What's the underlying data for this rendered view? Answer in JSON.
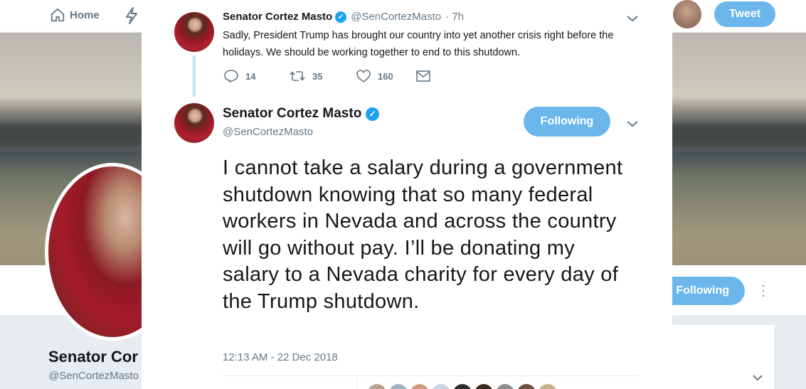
{
  "nav": {
    "home_label": "Home",
    "tweet_button": "Tweet"
  },
  "profile": {
    "name": "Senator Cor",
    "handle": "@SenCortezMasto",
    "following_button": "Following"
  },
  "thread": [
    {
      "author": "Senator Cortez Masto",
      "handle": "@SenCortezMasto",
      "time": "· 7h",
      "text": "Sadly, President Trump has brought our country into yet another crisis right before the holidays. We should be working together to end to this shutdown.",
      "replies": "14",
      "retweets": "35",
      "likes": "160"
    }
  ],
  "main_tweet": {
    "author": "Senator Cortez Masto",
    "handle": "@SenCortezMasto",
    "following_button": "Following",
    "text": "I cannot take a salary during a government shutdown knowing that so many federal workers in Nevada and across the country will go without pay. I’ll be donating my salary to a Nevada charity for every day of the Trump shutdown.",
    "timestamp": "12:13 AM - 22 Dec 2018"
  },
  "icons": {
    "home": "home-icon",
    "moments": "lightning-icon",
    "verified": "verified-badge-icon",
    "reply": "reply-icon",
    "retweet": "retweet-icon",
    "like": "heart-icon",
    "dm": "envelope-icon",
    "chevron": "chevron-down-icon",
    "more": "more-vertical-icon"
  },
  "colors": {
    "accent": "#1da1f2",
    "following_bg": "#6bb7ec",
    "muted_text": "#657786",
    "text": "#14171a"
  }
}
